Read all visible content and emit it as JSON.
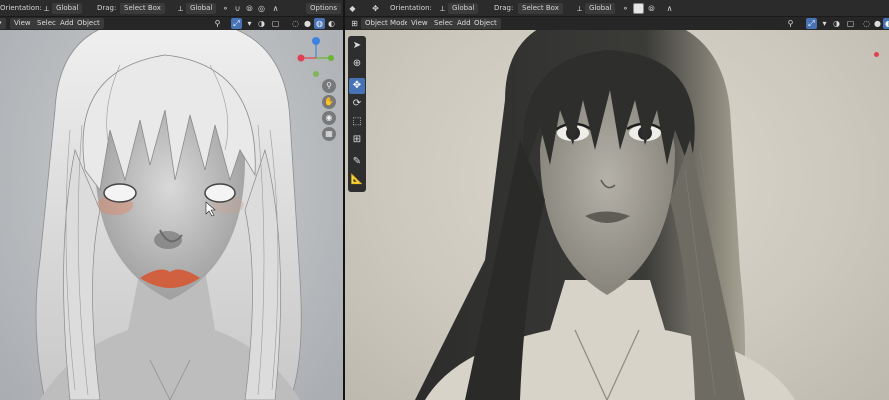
{
  "header": {
    "orientation_label": "Orientation:",
    "orientation_value": "Global",
    "drag_label": "Drag:",
    "drag_value": "Select Box",
    "pivot_value": "Global",
    "options_label": "Options",
    "left_orientation_value": "Global",
    "left_drag_value": "Select Box",
    "left_pivot_value": "Global"
  },
  "left_viewport": {
    "menu": {
      "view": "View",
      "select": "Select",
      "add": "Add",
      "object": "Object"
    }
  },
  "right_viewport": {
    "mode": "Object Mode",
    "menu": {
      "view": "View",
      "select": "Select",
      "add": "Add",
      "object": "Object"
    }
  },
  "icons": {
    "move": "move-arrows-icon",
    "snap": "magnet-icon",
    "proportional": "proportional-edit-icon",
    "overlay": "overlay-icon",
    "shading": "shading-icon",
    "gizmo": "gizmo-icon",
    "zoom": "zoom-icon",
    "pan": "pan-hand-icon",
    "camera": "camera-icon",
    "grid": "grid-icon",
    "cursor_tool": "select-cursor-icon",
    "cursor3d": "3d-cursor-icon",
    "move_tool": "move-tool-icon",
    "rotate_tool": "rotate-tool-icon",
    "scale_tool": "scale-tool-icon",
    "transform_tool": "transform-tool-icon",
    "annotate_tool": "annotate-tool-icon",
    "measure_tool": "measure-tool-icon"
  },
  "colors": {
    "accent": "#4772b3",
    "gizmo_x": "#e0404f",
    "gizmo_y": "#6ab531",
    "gizmo_z": "#3e83e0",
    "lip_color": "#d06040"
  }
}
